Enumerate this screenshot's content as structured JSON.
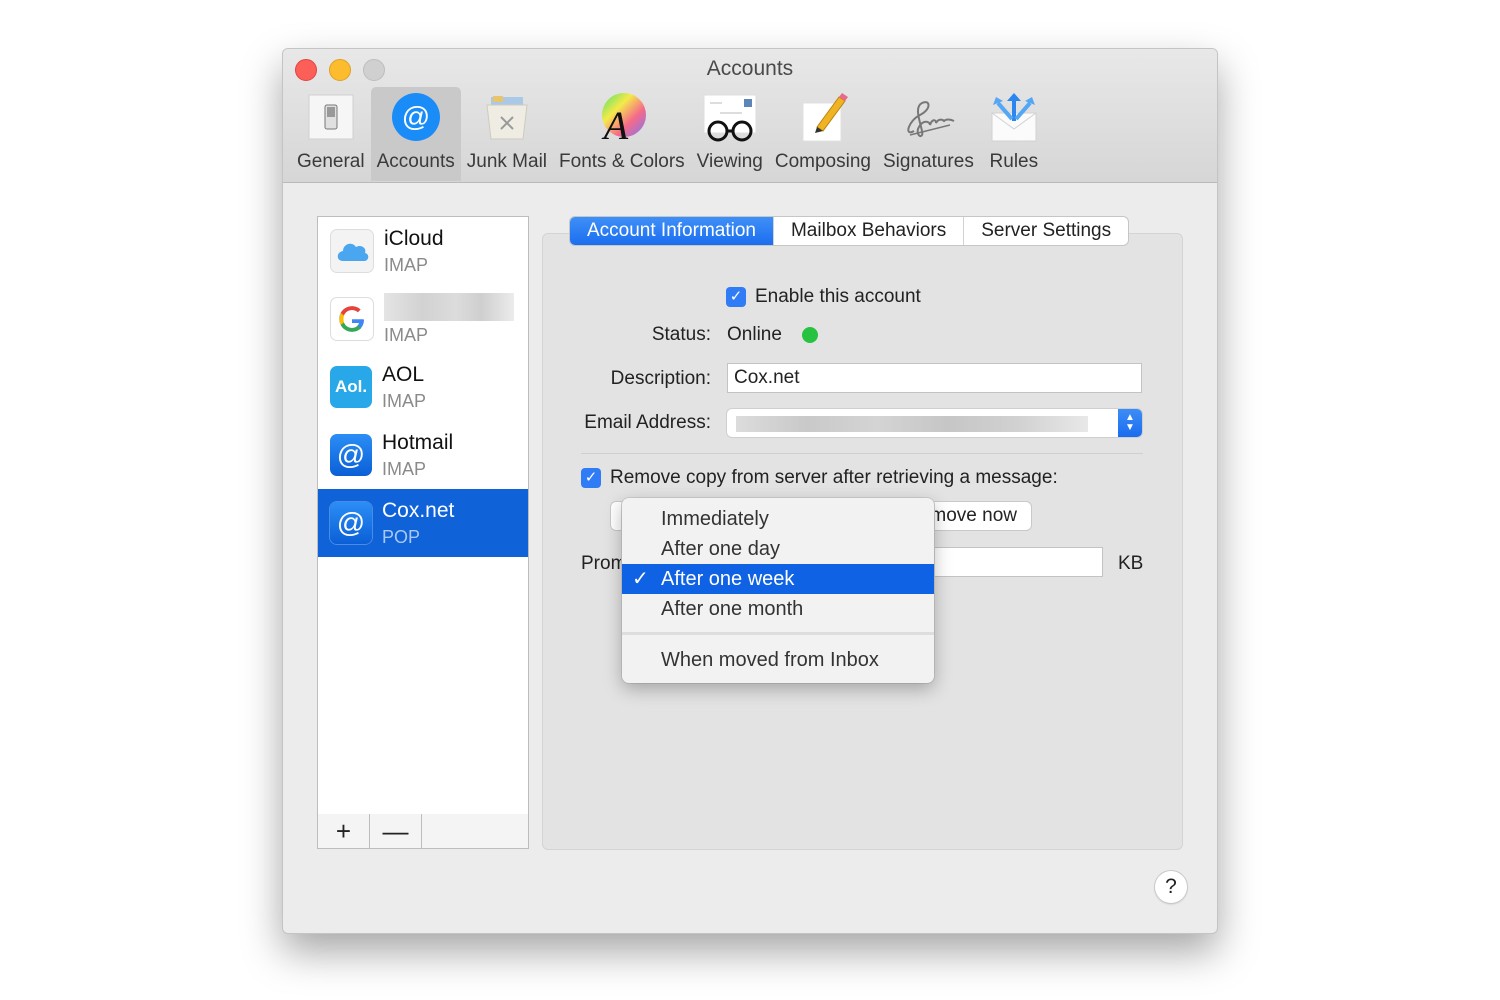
{
  "window": {
    "title": "Accounts"
  },
  "toolbar": [
    {
      "label": "General",
      "icon": "switch-icon"
    },
    {
      "label": "Accounts",
      "icon": "at-icon",
      "active": true
    },
    {
      "label": "Junk Mail",
      "icon": "trash-icon"
    },
    {
      "label": "Fonts & Colors",
      "icon": "font-color-icon"
    },
    {
      "label": "Viewing",
      "icon": "glasses-icon"
    },
    {
      "label": "Composing",
      "icon": "pencil-icon"
    },
    {
      "label": "Signatures",
      "icon": "signature-icon"
    },
    {
      "label": "Rules",
      "icon": "rules-icon"
    }
  ],
  "accounts": [
    {
      "name": "iCloud",
      "type": "IMAP"
    },
    {
      "name": "",
      "type": "IMAP"
    },
    {
      "name": "AOL",
      "type": "IMAP"
    },
    {
      "name": "Hotmail",
      "type": "IMAP"
    },
    {
      "name": "Cox.net",
      "type": "POP",
      "selected": true
    }
  ],
  "list_footer": {
    "add": "+",
    "remove": "—"
  },
  "tabs": [
    "Account Information",
    "Mailbox Behaviors",
    "Server Settings"
  ],
  "form": {
    "enable_label": "Enable this account",
    "enable_checked": true,
    "status_label": "Status:",
    "status_value": "Online",
    "status_color": "#27c23f",
    "description_label": "Description:",
    "description_value": "Cox.net",
    "email_label": "Email Address:",
    "remove_label": "Remove copy from server after retrieving a message:",
    "remove_checked": true,
    "remove_now_button": "move now",
    "prompt_label_partial": "Prom",
    "kb_label": "KB"
  },
  "dropdown": {
    "options": [
      "Immediately",
      "After one day",
      "After one week",
      "After one month",
      "When moved from Inbox"
    ],
    "selected": "After one week",
    "check": "✓"
  },
  "help": "?",
  "colors": {
    "accent": "#1b6ef0",
    "selection": "#0f62d8"
  }
}
